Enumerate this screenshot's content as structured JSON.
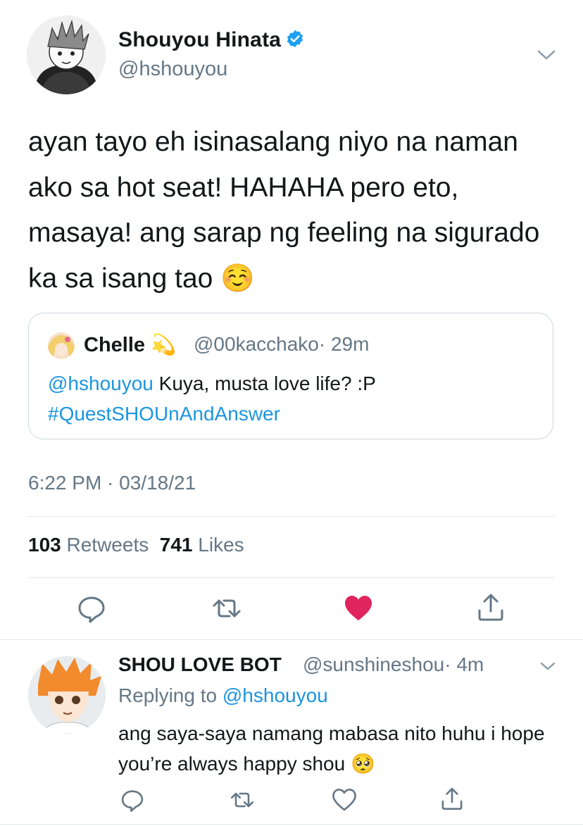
{
  "tweet": {
    "author_name": "Shouyou Hinata",
    "author_handle": "@hshouyou",
    "text": "ayan tayo eh isinasalang niyo na naman ako sa hot seat! HAHAHA pero eto, masaya! ang sarap ng feeling na sigurado ka sa isang tao",
    "emoji": "☺️",
    "timestamp": "6:22 PM · 03/18/21",
    "retweets_count": "103",
    "retweets_label": "Retweets",
    "likes_count": "741",
    "likes_label": "Likes"
  },
  "quote": {
    "author_name": "Chelle",
    "name_emoji": "💫",
    "author_handle": "@00kacchako",
    "time": "· 29m",
    "mention": "@hshouyou",
    "text": " Kuya, musta love life? :P",
    "hashtag": "#QuestSHOUnAndAnswer"
  },
  "reply": {
    "author_name": "SHOU LOVE BOT",
    "author_handle": "@sunshineshou",
    "time": "· 4m",
    "replying_label": "Replying to",
    "replying_to": "@hshouyou",
    "text": "ang saya-saya namang mabasa nito huhu i hope you’re always happy shou",
    "emoji": "🥺"
  },
  "icons": {
    "verified": "verified-badge-icon",
    "more": "chevron-down-icon",
    "reply": "reply-icon",
    "retweet": "retweet-icon",
    "like": "heart-icon",
    "share": "share-icon"
  },
  "colors": {
    "link": "#1b95e0",
    "like_active": "#e0245e",
    "secondary_text": "#657786",
    "divider": "#e1e8ed"
  }
}
